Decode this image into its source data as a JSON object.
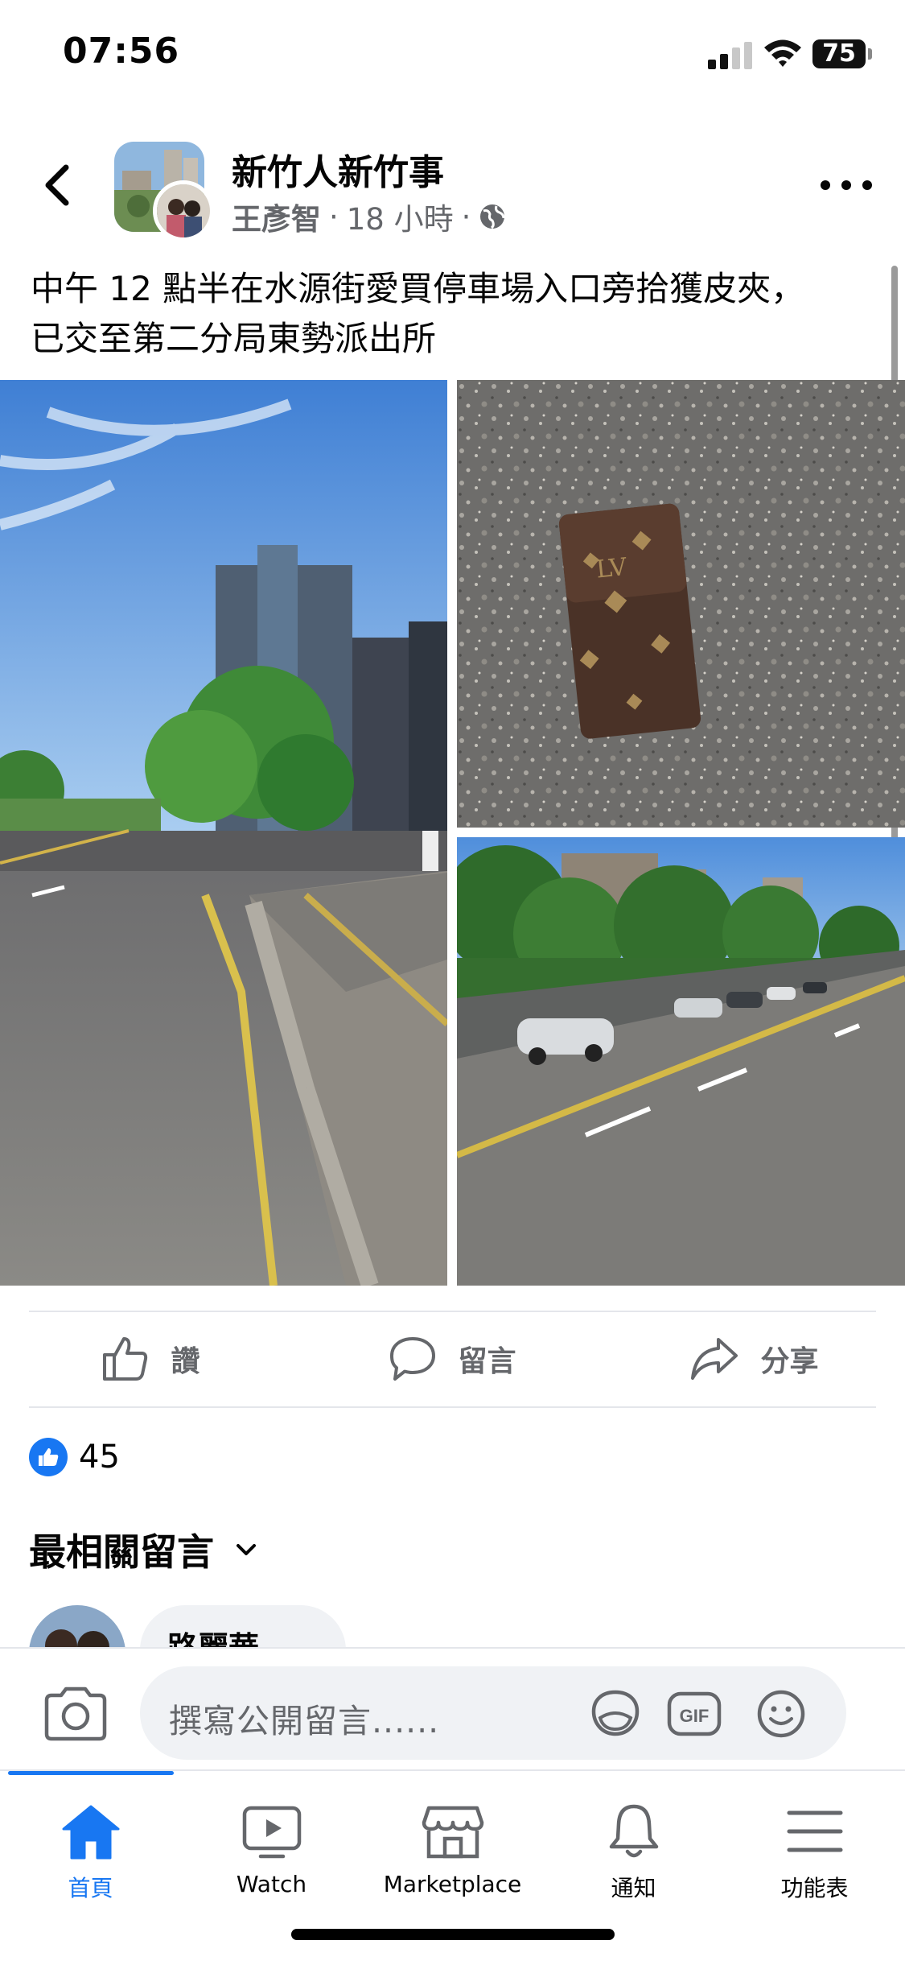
{
  "status_bar": {
    "time": "07:56",
    "battery": "75"
  },
  "post": {
    "group_name": "新竹人新竹事",
    "author": "王彥智",
    "time_ago": "18 小時",
    "separator": "·",
    "text_line1": "中午 12 點半在水源街愛買停車場入口旁拾獲皮夾，",
    "text_line2": "已交至第二分局東勢派出所"
  },
  "actions": {
    "like": "讚",
    "comment": "留言",
    "share": "分享"
  },
  "reactions": {
    "count": "45"
  },
  "comments": {
    "filter_label": "最相關留言",
    "first_author": "路麗華"
  },
  "composer": {
    "placeholder": "撰寫公開留言......",
    "gif_label": "GIF"
  },
  "tabs": [
    {
      "label": "首頁",
      "icon": "home-icon"
    },
    {
      "label": "Watch",
      "icon": "video-icon"
    },
    {
      "label": "Marketplace",
      "icon": "marketplace-icon"
    },
    {
      "label": "通知",
      "icon": "bell-icon"
    },
    {
      "label": "功能表",
      "icon": "menu-icon"
    }
  ],
  "colors": {
    "accent": "#1877f2",
    "secondary_text": "#65676b",
    "divider": "#e4e6eb"
  }
}
